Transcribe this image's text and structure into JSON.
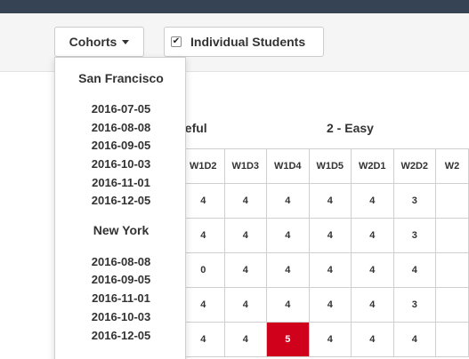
{
  "toolbar": {
    "cohorts_label": "Cohorts",
    "individual_label": "Individual Students",
    "individual_checked": true
  },
  "dropdown": {
    "groups": [
      {
        "title": "San Francisco",
        "dates": [
          "2016-07-05",
          "2016-08-08",
          "2016-09-05",
          "2016-10-03",
          "2016-11-01",
          "2016-12-05"
        ]
      },
      {
        "title": "New York",
        "dates": [
          "2016-08-08",
          "2016-09-05",
          "2016-11-01",
          "2016-10-03",
          "2016-12-05"
        ]
      }
    ]
  },
  "grid": {
    "group_labels": [
      "seful",
      "2 - Easy"
    ],
    "columns": [
      "W1D2",
      "W1D3",
      "W1D4",
      "W1D5",
      "W2D1",
      "W2D2",
      "W2"
    ],
    "rows": [
      [
        "4",
        "4",
        "4",
        "4",
        "4",
        "3",
        ""
      ],
      [
        "4",
        "4",
        "4",
        "4",
        "4",
        "3",
        ""
      ],
      [
        "0",
        "4",
        "4",
        "4",
        "4",
        "4",
        ""
      ],
      [
        "4",
        "4",
        "4",
        "4",
        "4",
        "3",
        ""
      ],
      [
        "4",
        "4",
        "5",
        "4",
        "4",
        "4",
        ""
      ]
    ],
    "highlight_color": "#d0021b"
  }
}
